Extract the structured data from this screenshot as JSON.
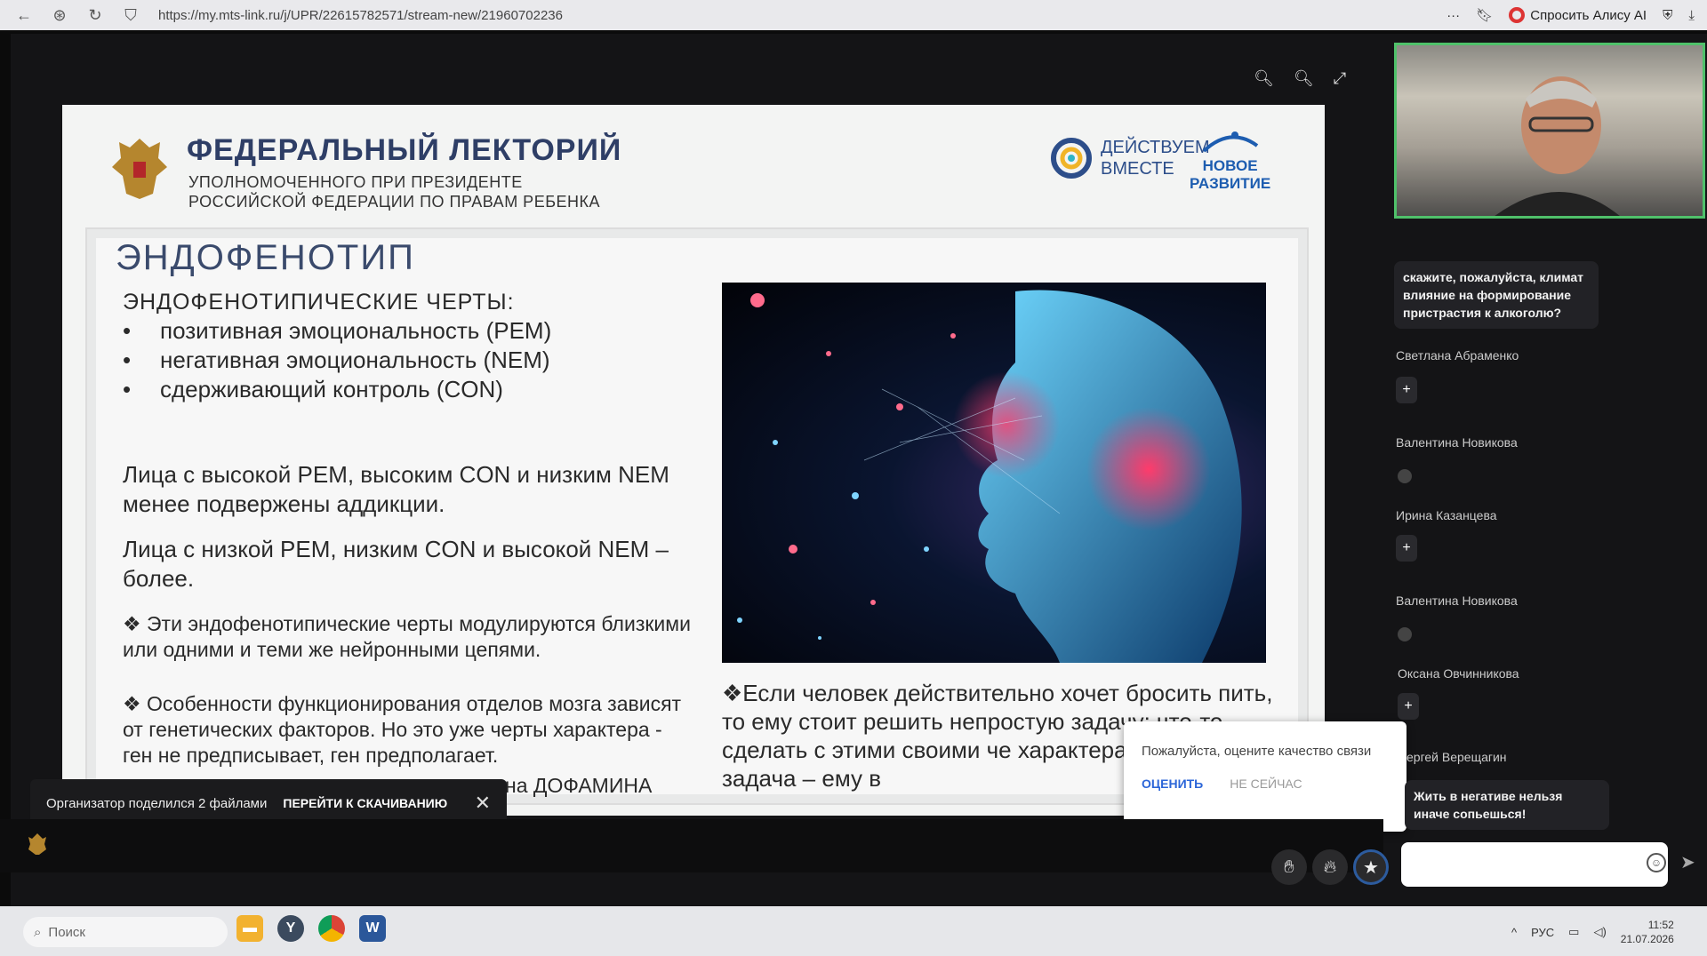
{
  "browser": {
    "url": "https://my.mts-link.ru/j/UPR/22615782571/stream-new/21960702236",
    "alice_label": "Спросить Алису AI"
  },
  "slide": {
    "lectorium_title": "ФЕДЕРАЛЬНЫЙ ЛЕКТОРИЙ",
    "lectorium_sub1": "УПОЛНОМОЧЕННОГО ПРИ ПРЕЗИДЕНТЕ",
    "lectorium_sub2": "РОССИЙСКОЙ ФЕДЕРАЦИИ ПО ПРАВАМ РЕБЕНКА",
    "partner1_line1": "ДЕЙСТВУЕМ",
    "partner1_line2": "ВМЕСТЕ",
    "partner2_line1": "НОВОЕ",
    "partner2_line2": "РАЗВИТИЕ",
    "title": "ЭНДОФЕНОТИП",
    "traits_heading": "ЭНДОФЕНОТИПИЧЕСКИЕ ЧЕРТЫ:",
    "traits": [
      "позитивная эмоциональность (PEM)",
      "негативная эмоциональность (NEM)",
      "сдерживающий контроль (CON)"
    ],
    "para1": "Лица с высокой PEM, высоким CON и низким NEM менее подвержены аддикции.",
    "para2": "Лица с низкой PEM, низким CON и высокой NEM – более.",
    "para3": "❖ Эти эндофенотипические черты модулируются близкими или одними и теми же нейронными цепями.",
    "para4": "❖ Особенности функционирования отделов мозга зависят от генетических факторов. Но это уже черты характера - ген не предписывает, ген предполагает.",
    "para4_tail": "на ДОФАМИНА",
    "right_para": "❖Если человек действительно хочет бросить пить, то ему стоит решить непростую задачу: что-то сделать с этими своими че характера, а наша задача – ему в"
  },
  "toast": {
    "text": "Организатор поделился 2 файлами",
    "action": "ПЕРЕЙТИ К СКАЧИВАНИЮ"
  },
  "rate": {
    "question": "Пожалуйста, оцените качество связи",
    "ok": "ОЦЕНИТЬ",
    "later": "НЕ СЕЙЧАС"
  },
  "chat": {
    "msg1": "скажите, пожалуйста, климат влияние на формирование пристрастия к алкоголю?",
    "authors": [
      "Светлана Абраменко",
      "Валентина Новикова",
      "Ирина Казанцева",
      "Валентина Новикова",
      "Оксана Овчинникова",
      "ергей Верещагин"
    ],
    "msg_last": "Жить в негативе нельзя иначе сопьешься!"
  },
  "taskbar": {
    "search": "Поиск",
    "lang": "РУС",
    "time": "11:52",
    "date": "21.07.2026"
  }
}
